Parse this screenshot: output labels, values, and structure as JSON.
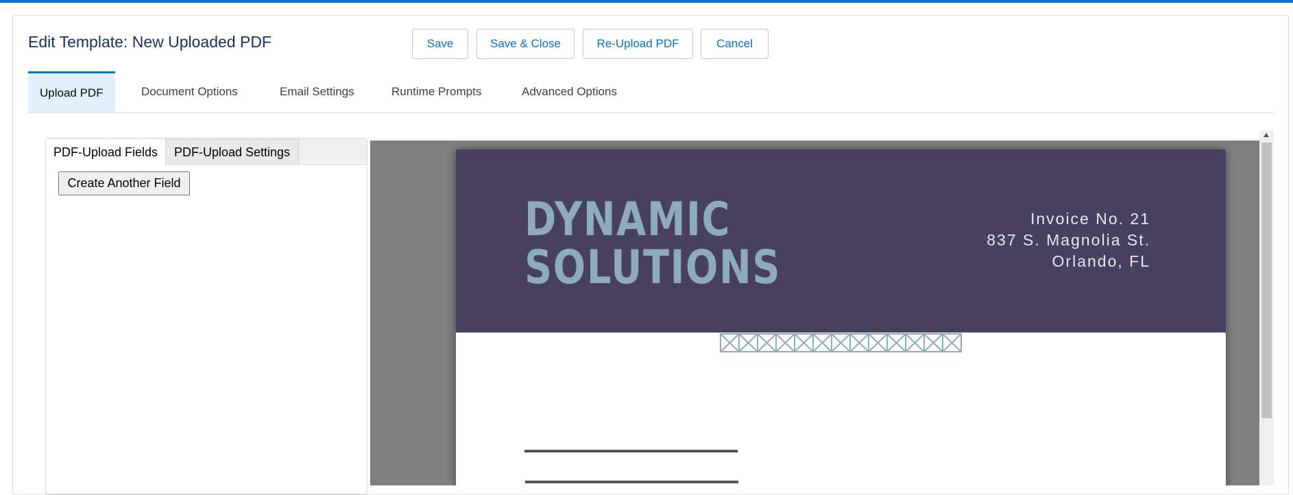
{
  "header": {
    "title": "Edit Template: New Uploaded PDF",
    "buttons": {
      "save": "Save",
      "save_close": "Save & Close",
      "reupload": "Re-Upload PDF",
      "cancel": "Cancel"
    }
  },
  "tabs": [
    {
      "label": "Upload PDF",
      "active": true
    },
    {
      "label": "Document Options"
    },
    {
      "label": "Email Settings"
    },
    {
      "label": "Runtime Prompts"
    },
    {
      "label": "Advanced Options"
    }
  ],
  "left_panel": {
    "subtabs": [
      {
        "label": "PDF-Upload Fields",
        "active": true
      },
      {
        "label": "PDF-Upload Settings"
      }
    ],
    "create_button": "Create Another Field"
  },
  "pdf_preview": {
    "company_line1": "DYNAMIC",
    "company_line2": "SOLUTIONS",
    "invoice_no": "Invoice No. 21",
    "address_line1": "837 S. Magnolia St.",
    "address_line2": "Orlando, FL"
  },
  "colors": {
    "accent": "#0b6ec8",
    "link": "#0070d2",
    "title": "#16325c",
    "invoice_band": "#47415f",
    "company_text": "#8dabb8",
    "viewer_bg": "#808080"
  }
}
